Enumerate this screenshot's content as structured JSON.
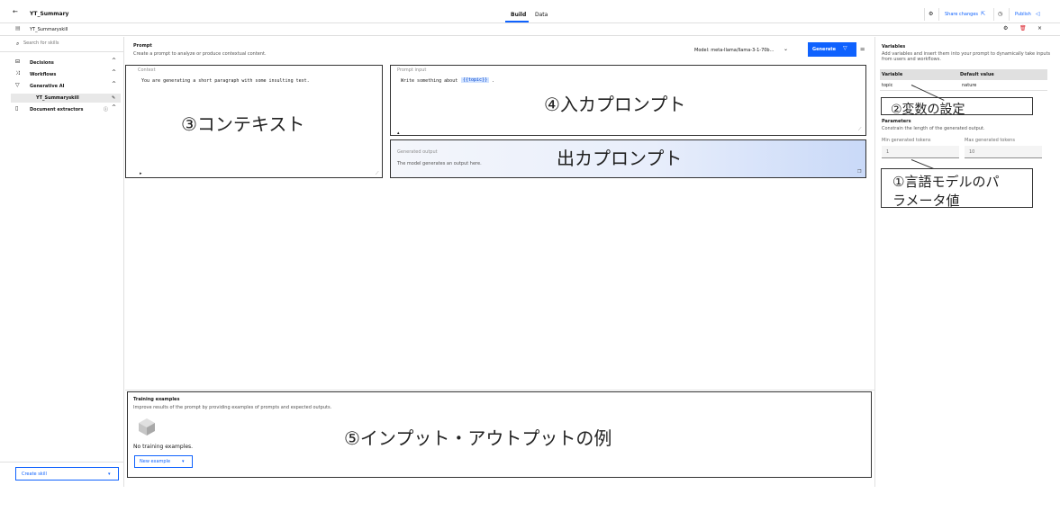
{
  "header": {
    "back_icon": "arrow-left",
    "app_title": "YT_Summary",
    "tabs": [
      {
        "label": "Build",
        "active": true
      },
      {
        "label": "Data",
        "active": false
      }
    ],
    "share_label": "Share changes",
    "publish_label": "Publish"
  },
  "subheader": {
    "skill_name": "YT_Summaryskill"
  },
  "sidebar": {
    "search_placeholder": "Search for skills",
    "items": [
      {
        "label": "Decisions"
      },
      {
        "label": "Workflows"
      },
      {
        "label": "Generative AI"
      },
      {
        "label": "YT_Summaryskill"
      },
      {
        "label": "Document extractors"
      }
    ],
    "create_label": "Create skill"
  },
  "prompt": {
    "title": "Prompt",
    "subtitle": "Create a prompt to analyze or produce contextual content.",
    "model_label": "Model: meta-llama/llama-3-1-70b...",
    "generate_label": "Generate"
  },
  "context": {
    "label": "Context",
    "text": "You are generating a short paragraph with some insulting text."
  },
  "prompt_input": {
    "label": "Prompt input",
    "text_prefix": "Write something about",
    "variable_token": "{{topic}}",
    "text_suffix": "."
  },
  "generated_output": {
    "label": "Generated output",
    "placeholder": "The model generates an output here."
  },
  "training": {
    "title": "Training examples",
    "subtitle": "Improve results of the prompt by providing examples of prompts and expected outputs.",
    "empty_text": "No training examples.",
    "new_example_label": "New example"
  },
  "variables": {
    "title": "Variables",
    "subtitle": "Add variables and insert them into your prompt to dynamically take inputs from users and workflows.",
    "col_variable": "Variable",
    "col_default": "Default value",
    "rows": [
      {
        "variable": "topic",
        "default": "nature"
      }
    ]
  },
  "parameters": {
    "title": "Parameters",
    "subtitle": "Constrain the length of the generated output.",
    "min_label": "Min generated tokens",
    "min_value": "1",
    "max_label": "Max generated tokens",
    "max_value": "10"
  },
  "annotations": {
    "context": "③コンテキスト",
    "input": "④入カプロンプト",
    "output": "出カプロンプト",
    "variables": "②変数の設定",
    "params_line1": "①言語モデルのパ",
    "params_line2": "ラメータ値",
    "examples": "⑤インプット・アウトプットの例"
  }
}
